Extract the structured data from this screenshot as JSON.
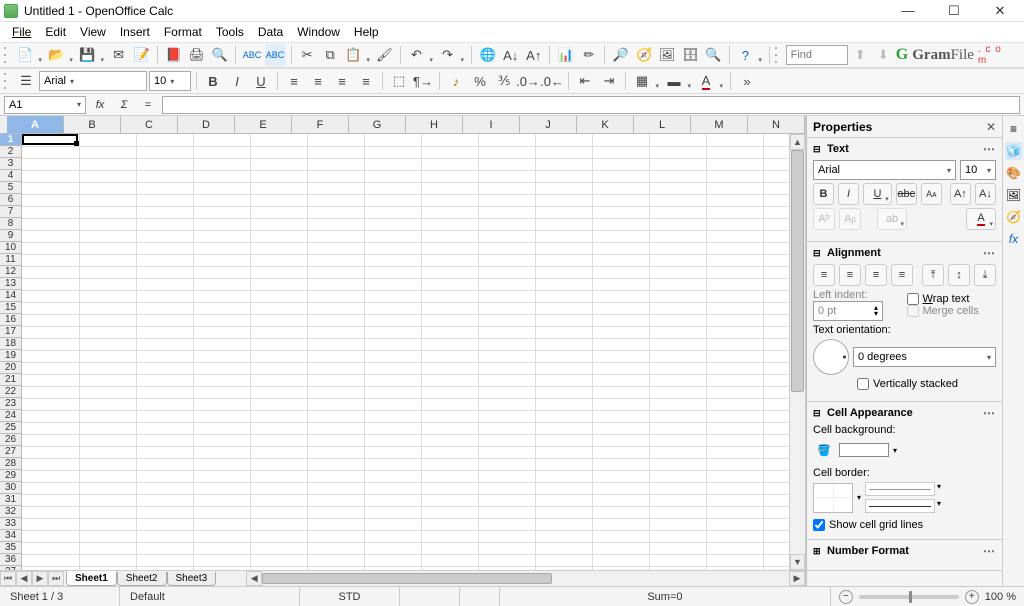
{
  "title": "Untitled 1 - OpenOffice Calc",
  "menu": [
    "File",
    "Edit",
    "View",
    "Insert",
    "Format",
    "Tools",
    "Data",
    "Window",
    "Help"
  ],
  "find_placeholder": "Find",
  "brand": {
    "g": "G",
    "gram": "Gram",
    "file": "File",
    "com": ". c o m"
  },
  "font": {
    "name": "Arial",
    "size": "10"
  },
  "cell_ref": "A1",
  "columns": [
    "A",
    "B",
    "C",
    "D",
    "E",
    "F",
    "G",
    "H",
    "I",
    "J",
    "K",
    "L",
    "M",
    "N"
  ],
  "row_count": 38,
  "sheets": [
    "Sheet1",
    "Sheet2",
    "Sheet3"
  ],
  "active_sheet": 0,
  "sidebar": {
    "title": "Properties",
    "text": {
      "title": "Text",
      "font": "Arial",
      "size": "10"
    },
    "align": {
      "title": "Alignment",
      "indent_label": "Left indent:",
      "indent_value": "0 pt",
      "wrap": "Wrap text",
      "merge": "Merge cells",
      "orient_label": "Text orientation:",
      "orient_value": "0 degrees",
      "stacked": "Vertically stacked"
    },
    "appearance": {
      "title": "Cell Appearance",
      "bg_label": "Cell background:",
      "border_label": "Cell border:",
      "grid": "Show cell grid lines"
    },
    "number": {
      "title": "Number Format"
    }
  },
  "status": {
    "sheet": "Sheet 1 / 3",
    "style": "Default",
    "mode": "STD",
    "sum": "Sum=0",
    "zoom": "100 %"
  }
}
